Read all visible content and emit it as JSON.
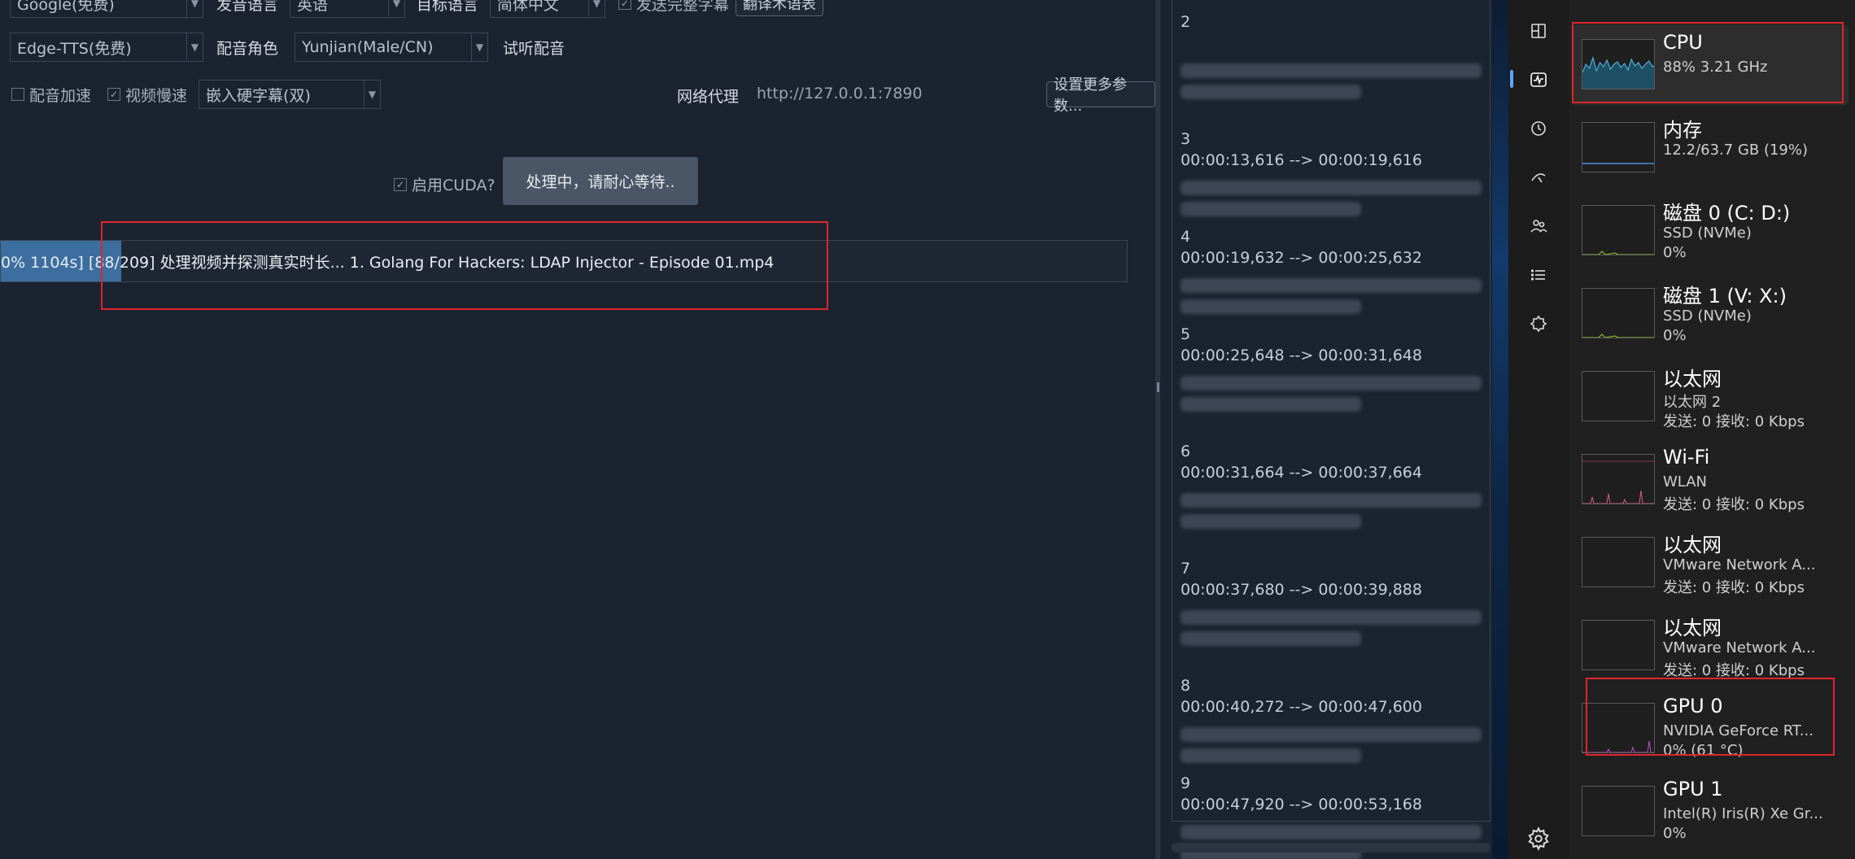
{
  "app": {
    "row1": {
      "translate_engine": "Google(免费)",
      "source_lang_label": "发音语言",
      "source_lang": "英语",
      "target_lang_label": "目标语言",
      "target_lang": "简体中文",
      "send_full_subs_label": "发送完整字幕",
      "glossary_button": "翻译术语表"
    },
    "row2": {
      "tts_engine": "Edge-TTS(免费)",
      "voice_role_label": "配音角色",
      "voice_role": "Yunjian(Male/CN)",
      "listen_label": "试听配音"
    },
    "row3": {
      "voice_speedup_label": "配音加速",
      "video_slowdown_label": "视频慢速",
      "subtitle_mode": "嵌入硬字幕(双)",
      "proxy_label": "网络代理",
      "proxy_value": "http://127.0.0.1:7890",
      "more_settings_button": "设置更多参数..."
    },
    "cuda_label": "启用CUDA?",
    "process_button": "处理中，请耐心等待..",
    "progress": {
      "text": "0%  1104s]  [88/209] 处理视频并探测真实时长... 1. Golang For Hackers:  LDAP Injector - Episode 01.mp4",
      "fraction": 0.107
    }
  },
  "subtitles": [
    {
      "num": "2",
      "time": ""
    },
    {
      "num": "3",
      "time": "00:00:13,616 --> 00:00:19,616"
    },
    {
      "num": "4",
      "time": "00:00:19,632 --> 00:00:25,632"
    },
    {
      "num": "5",
      "time": "00:00:25,648 --> 00:00:31,648"
    },
    {
      "num": "6",
      "time": "00:00:31,664 --> 00:00:37,664"
    },
    {
      "num": "7",
      "time": "00:00:37,680 --> 00:00:39,888"
    },
    {
      "num": "8",
      "time": "00:00:40,272 --> 00:00:47,600"
    },
    {
      "num": "9",
      "time": "00:00:47,920 --> 00:00:53,168"
    }
  ],
  "task_manager": {
    "items": [
      {
        "title": "CPU",
        "sub1": "88%  3.21 GHz",
        "sub2": "",
        "graph_color": "#4ab0e0"
      },
      {
        "title": "内存",
        "sub1": "12.2/63.7 GB (19%)",
        "sub2": "",
        "graph_color": "#4a8fe0"
      },
      {
        "title": "磁盘 0 (C: D:)",
        "sub1": "SSD (NVMe)",
        "sub2": "0%",
        "graph_color": "#9acd32"
      },
      {
        "title": "磁盘 1 (V: X:)",
        "sub1": "SSD (NVMe)",
        "sub2": "0%",
        "graph_color": "#9acd32"
      },
      {
        "title": "以太网",
        "sub1": "以太网 2",
        "sub2": "发送: 0 接收: 0 Kbps",
        "graph_color": "#e05a8a"
      },
      {
        "title": "Wi-Fi",
        "sub1": "WLAN",
        "sub2": "发送: 0 接收: 0 Kbps",
        "graph_color": "#e05a8a"
      },
      {
        "title": "以太网",
        "sub1": "VMware Network A...",
        "sub2": "发送: 0 接收: 0 Kbps",
        "graph_color": "#e05a8a"
      },
      {
        "title": "以太网",
        "sub1": "VMware Network A...",
        "sub2": "发送: 0 接收: 0 Kbps",
        "graph_color": "#e05a8a"
      },
      {
        "title": "GPU 0",
        "sub1": "NVIDIA GeForce RT...",
        "sub2": "0%  (61 °C)",
        "graph_color": "#c050d0"
      },
      {
        "title": "GPU 1",
        "sub1": "Intel(R) Iris(R) Xe Gr...",
        "sub2": "0%",
        "graph_color": "#c050d0"
      }
    ]
  }
}
